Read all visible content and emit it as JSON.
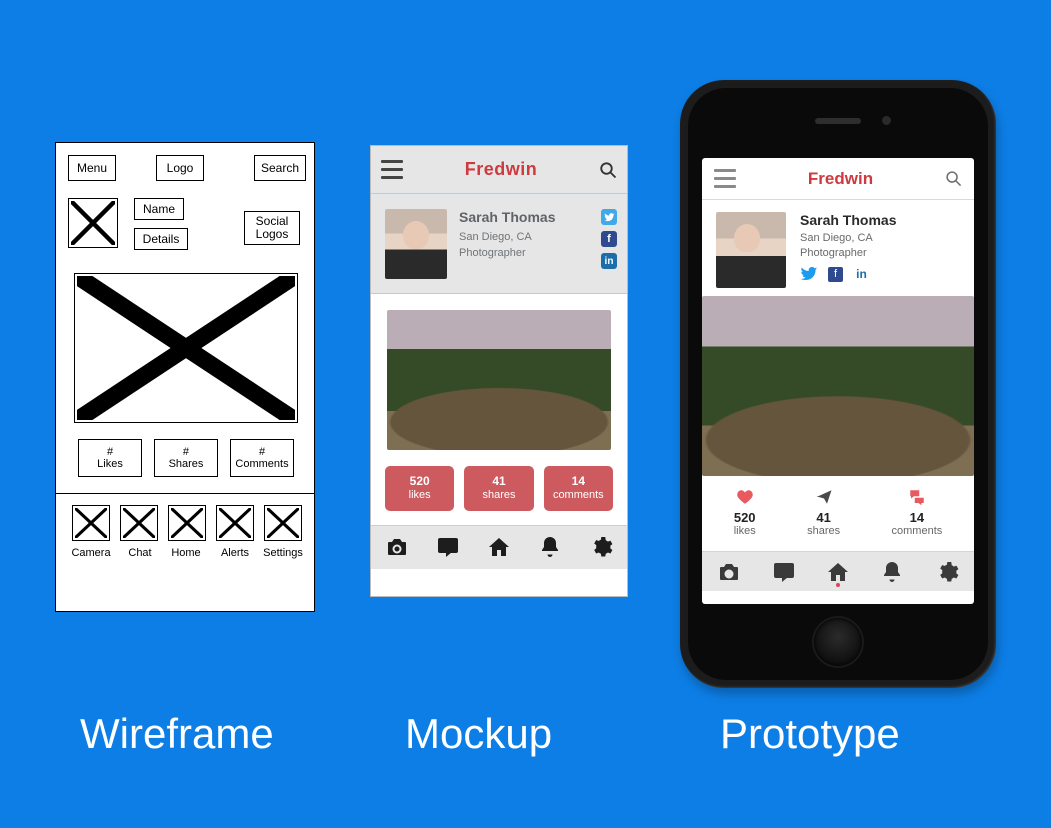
{
  "captions": {
    "wireframe": "Wireframe",
    "mockup": "Mockup",
    "prototype": "Prototype"
  },
  "wireframe": {
    "header": {
      "menu": "Menu",
      "logo": "Logo",
      "search": "Search"
    },
    "profile": {
      "name": "Name",
      "details": "Details",
      "social": "Social\nLogos"
    },
    "stats": [
      {
        "count": "#",
        "label": "Likes"
      },
      {
        "count": "#",
        "label": "Shares"
      },
      {
        "count": "#",
        "label": "Comments"
      }
    ],
    "nav": [
      "Camera",
      "Chat",
      "Home",
      "Alerts",
      "Settings"
    ]
  },
  "app": {
    "brand": "Fredwin",
    "profile": {
      "name": "Sarah Thomas",
      "location": "San Diego, CA",
      "role": "Photographer"
    },
    "stats": {
      "likes": {
        "count": "520",
        "label": "likes"
      },
      "shares": {
        "count": "41",
        "label": "shares"
      },
      "comments": {
        "count": "14",
        "label": "comments"
      }
    }
  }
}
